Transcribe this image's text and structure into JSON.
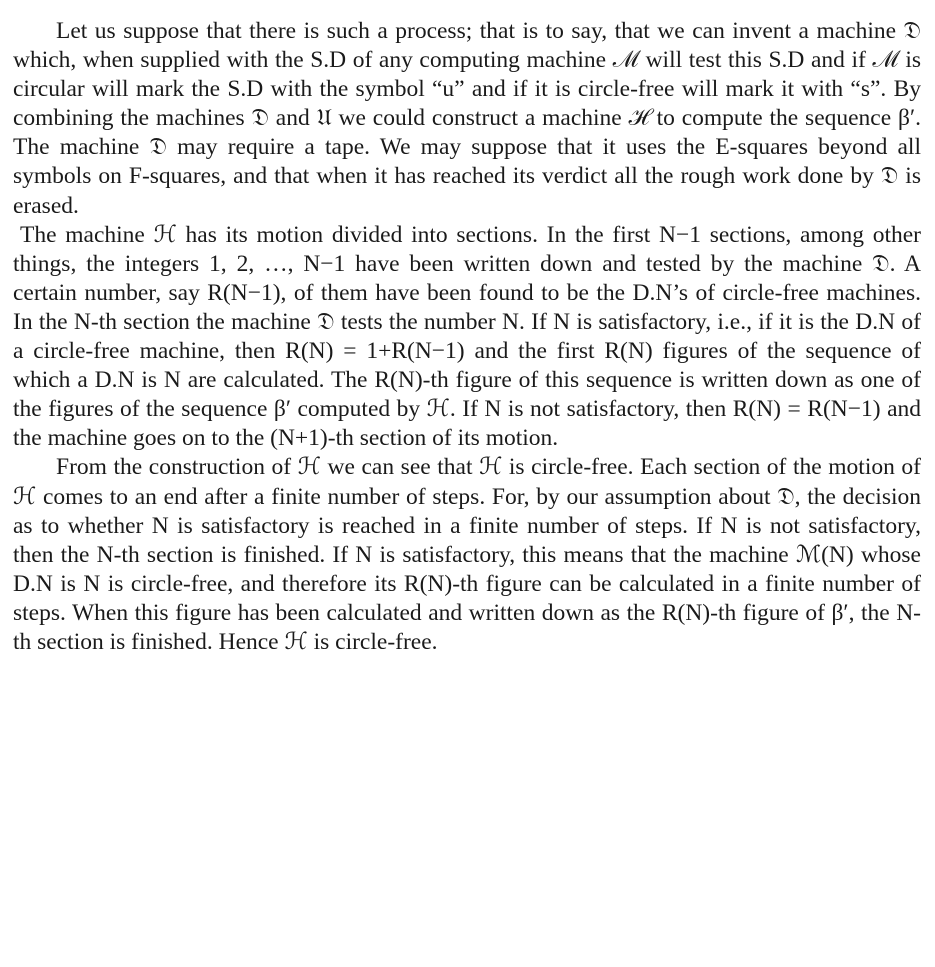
{
  "paragraphs": [
    {
      "text": "Let us suppose that there is such a process; that is to say, that we can invent a machine 𝔇 which, when supplied with the S.D of any computing machine ℳ will test this S.D and if ℳ is circular will mark the S.D with the symbol “u” and if it is circle-free will mark it with “s”. By combining the machines 𝔇 and 𝔘 we could construct a machine ℋ to compute the sequence β′. The machine 𝔇 may require a tape. We may suppose that it uses the E-squares beyond all symbols on F-squares, and that when it has reached its verdict all the rough work done by 𝔇 is erased."
    },
    {
      "text": "The machine ℋ has its motion divided into sections. In the first N−1 sections, among other things, the integers 1, 2, …, N−1 have been written down and tested by the machine 𝔇. A certain number, say R(N−1), of them have been found to be the D.N’s of circle-free machines. In the N-th section the machine 𝔇 tests the number N. If N is satisfactory, i.e., if it is the D.N of a circle-free machine, then R(N) = 1+R(N−1) and the first R(N) figures of the sequence of which a D.N is N are calculated. The R(N)-th figure of this sequence is written down as one of the figures of the sequence β′ computed by ℋ. If N is not satisfactory, then R(N) = R(N−1) and the machine goes on to the (N+1)-th section of its motion."
    },
    {
      "text": "From the construction of ℋ we can see that ℋ is circle-free. Each section of the motion of ℋ comes to an end after a finite number of steps. For, by our assumption about 𝔇, the decision as to whether N is satisfactory is reached in a finite number of steps. If N is not satisfactory, then the N-th section is finished. If N is satisfactory, this means that the machine ℳ(N) whose D.N is N is circle-free, and therefore its R(N)-th figure can be calculated in a finite number of steps. When this figure has been calculated and written down as the R(N)-th figure of β′, the N-th section is finished. Hence ℋ is circle-free."
    }
  ]
}
